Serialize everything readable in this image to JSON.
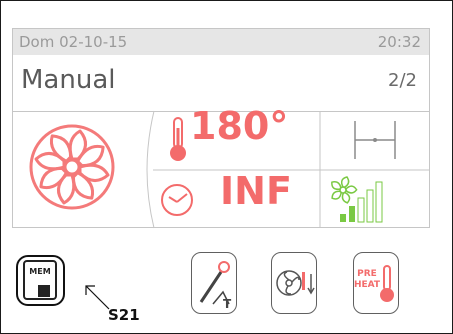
{
  "status": {
    "date": "Dom 02-10-15",
    "time": "20:32"
  },
  "mode": {
    "title": "Manual",
    "page": "2/2"
  },
  "readouts": {
    "temperature": "180°",
    "time": "INF"
  },
  "fan_speed_level": 2,
  "fan_speed_max": 5,
  "buttons": {
    "mem_label": "MEM",
    "preheat_label_1": "PRE",
    "preheat_label_2": "HEAT"
  },
  "annotation": "S21",
  "colors": {
    "accent_red": "#f36b6b",
    "accent_green": "#7ac943",
    "grid": "#c6c6c6"
  }
}
